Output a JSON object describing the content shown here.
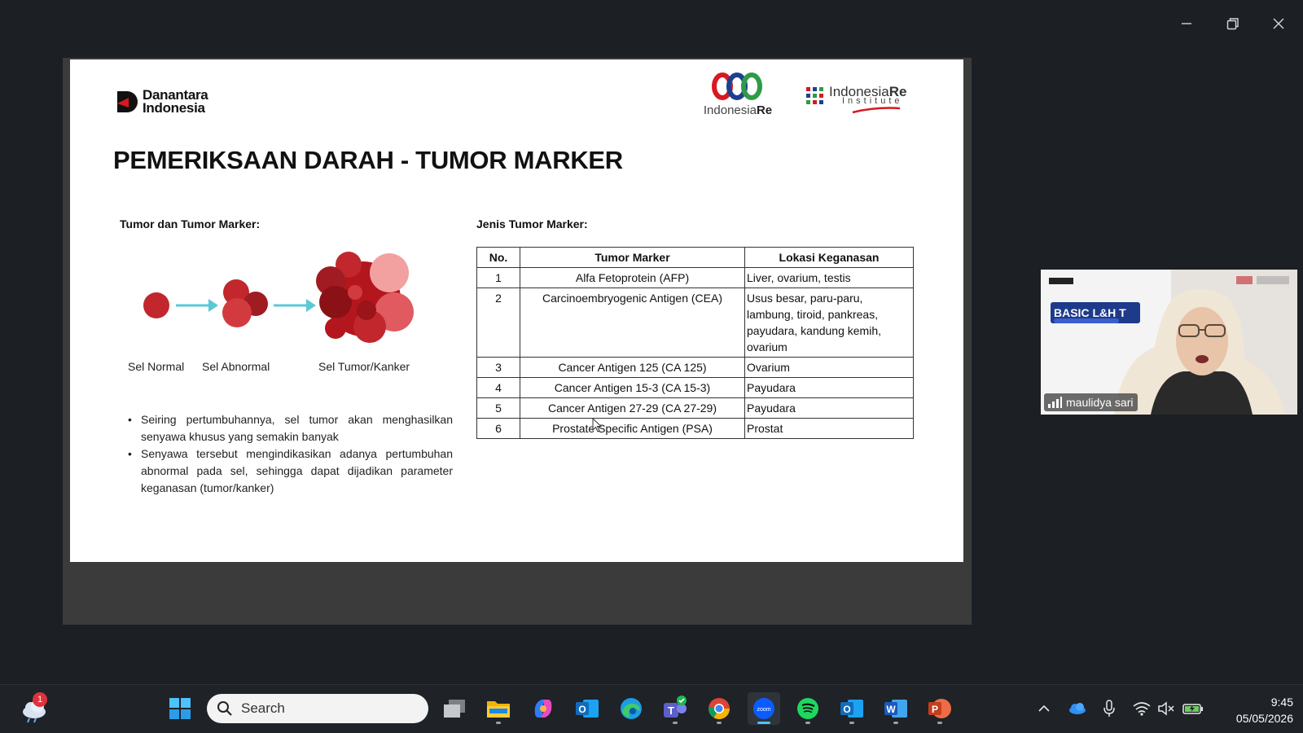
{
  "window": {
    "controls": [
      "minimize",
      "maximize",
      "close"
    ]
  },
  "slide": {
    "logos": {
      "danantara": [
        "Danantara",
        "Indonesia"
      ],
      "indonesia_re": {
        "prefix": "Indonesia",
        "suffix": "Re"
      },
      "indonesia_re_institute": {
        "prefix": "Indonesia",
        "suffix": "Re",
        "sub": "Institute"
      }
    },
    "title": "PEMERIKSAAN DARAH - TUMOR MARKER",
    "left": {
      "heading": "Tumor dan Tumor Marker:",
      "cell_labels": [
        "Sel Normal",
        "Sel Abnormal",
        "Sel Tumor/Kanker"
      ],
      "bullets": [
        "Seiring pertumbuhannya, sel tumor akan menghasilkan senyawa khusus yang semakin banyak",
        "Senyawa tersebut mengindikasikan adanya pertumbuhan abnormal pada sel, sehingga dapat dijadikan parameter keganasan (tumor/kanker)"
      ]
    },
    "right": {
      "heading": "Jenis Tumor Marker:",
      "columns": [
        "No.",
        "Tumor Marker",
        "Lokasi Keganasan"
      ],
      "rows": [
        [
          "1",
          "Alfa Fetoprotein (AFP)",
          "Liver, ovarium, testis"
        ],
        [
          "2",
          "Carcinoembryogenic Antigen (CEA)",
          "Usus besar, paru-paru, lambung, tiroid, pankreas, payudara, kandung kemih, ovarium"
        ],
        [
          "3",
          "Cancer Antigen 125 (CA 125)",
          "Ovarium"
        ],
        [
          "4",
          "Cancer Antigen 15-3 (CA 15-3)",
          "Payudara"
        ],
        [
          "5",
          "Cancer Antigen 27-29 (CA 27-29)",
          "Payudara"
        ],
        [
          "6",
          "Prostate Specific Antigen (PSA)",
          "Prostat"
        ]
      ]
    }
  },
  "webcam": {
    "participant": "maulidya sari",
    "background_text": "BASIC L&H T"
  },
  "taskbar": {
    "weather_badge": "1",
    "search_placeholder": "Search",
    "apps": [
      "task-view",
      "file-explorer",
      "copilot",
      "outlook",
      "edge",
      "teams",
      "chrome",
      "zoom",
      "spotify",
      "outlook-new",
      "word",
      "powerpoint"
    ],
    "clock": {
      "time": "9:45",
      "date": "05/05/2026"
    }
  }
}
